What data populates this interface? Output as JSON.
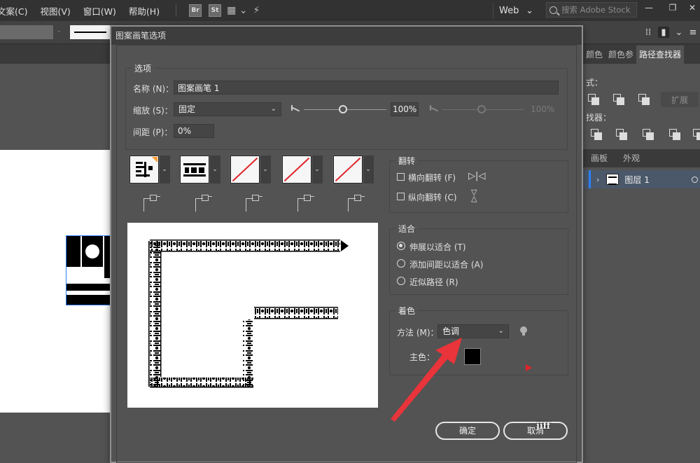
{
  "menubar": {
    "items": [
      "文案(C)",
      "视图(V)",
      "窗口(W)",
      "帮助(H)"
    ],
    "apps": [
      "Br",
      "St"
    ],
    "workspace": "Web",
    "stock_search_placeholder": "搜索 Adobe Stock"
  },
  "panels": {
    "top_tabs": [
      "颜色",
      "颜色参",
      "路径查找器"
    ],
    "shape_modes_label": "式：",
    "expand_label": "扩展",
    "pathfinder_label": "找器：",
    "layers_tabs": [
      "画板",
      "外观"
    ],
    "layer_name": "图层 1"
  },
  "dialog": {
    "title": "图案画笔选项",
    "options_group": "选项",
    "name_label": "名称 (N)：",
    "name_value": "图案画笔 1",
    "scale_label": "缩放 (S)：",
    "scale_mode": "固定",
    "scale_pct_1": "100%",
    "scale_pct_2": "100%",
    "spacing_label": "间距 (P)：",
    "spacing_value": "0%",
    "flip_group": "翻转",
    "flip_along": "横向翻转 (F)",
    "flip_across": "纵向翻转 (C)",
    "fit_group": "适合",
    "fit_options": [
      "伸展以适合 (T)",
      "添加间距以适合 (A)",
      "近似路径 (R)"
    ],
    "fit_selected": 0,
    "colorization_group": "着色",
    "method_label": "方法 (M)：",
    "method_value": "色调",
    "key_color_label": "主色：",
    "key_color": "#000000",
    "ok_label": "确定",
    "cancel_label": "取消"
  },
  "colors": {
    "annotation_arrow": "#e8343a",
    "layer_highlight": "#4b5869",
    "selection_blue": "#2a82ff"
  },
  "watermark": "jiff"
}
